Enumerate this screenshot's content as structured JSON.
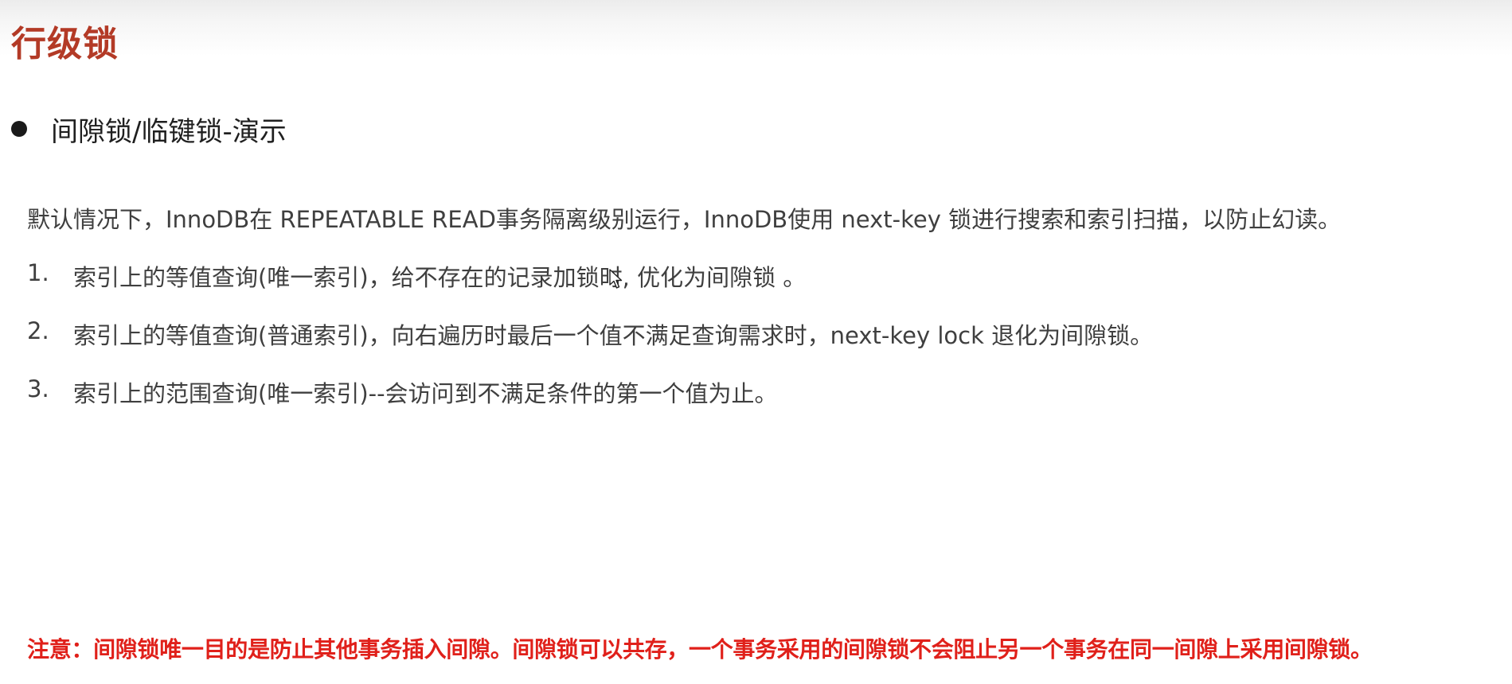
{
  "slide": {
    "title": "行级锁",
    "subtitle": "间隙锁/临键锁-演示",
    "intro": "默认情况下，InnoDB在 REPEATABLE READ事务隔离级别运行，InnoDB使用 next-key 锁进行搜索和索引扫描，以防止幻读。",
    "rules": [
      {
        "num": "1.",
        "text": "索引上的等值查询(唯一索引)，给不存在的记录加锁时, 优化为间隙锁 。"
      },
      {
        "num": "2.",
        "text": "索引上的等值查询(普通索引)，向右遍历时最后一个值不满足查询需求时，next-key lock 退化为间隙锁。"
      },
      {
        "num": "3.",
        "text": "索引上的范围查询(唯一索引)--会访问到不满足条件的第一个值为止。"
      }
    ],
    "note": "注意：间隙锁唯一目的是防止其他事务插入间隙。间隙锁可以共存，一个事务采用的间隙锁不会阻止另一个事务在同一间隙上采用间隙锁。"
  },
  "colors": {
    "title": "#b33a26",
    "note": "#e0201a",
    "body_text": "#3f3f3f"
  },
  "icons": {
    "cursor": "mouse-pointer-icon",
    "bullet": "bullet-dot-icon"
  }
}
